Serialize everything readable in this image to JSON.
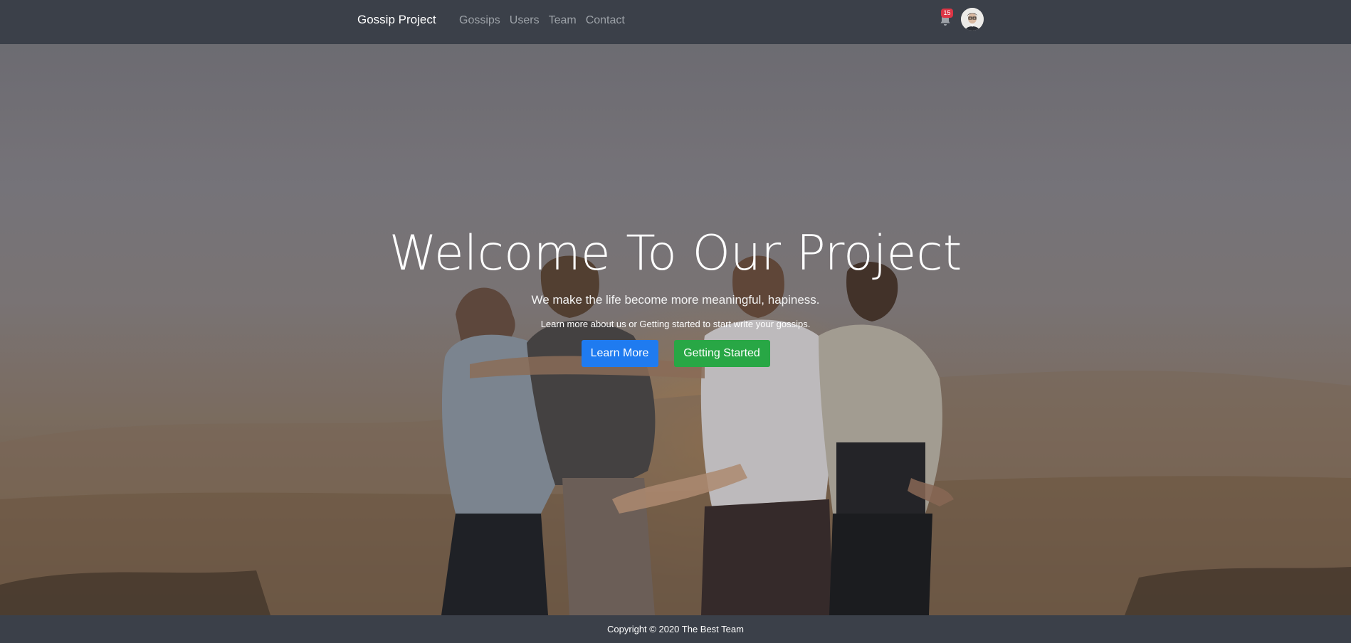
{
  "navbar": {
    "brand": "Gossip Project",
    "links": [
      "Gossips",
      "Users",
      "Team",
      "Contact"
    ],
    "notification_count": "15"
  },
  "hero": {
    "title": "Welcome To Our Project",
    "lead": "We make the life become more meaningful, hapiness.",
    "sub": "Learn more about us or Getting started to start write your gossips.",
    "primary_button": "Learn More",
    "secondary_button": "Getting Started"
  },
  "footer": {
    "copyright": "Copyright © 2020 The Best Team"
  },
  "icons": {
    "notifications": "bell-icon",
    "user": "avatar"
  },
  "colors": {
    "navbar": "#3b4049",
    "primary": "#1f7bf0",
    "success": "#28a745",
    "badge": "#dc3545"
  }
}
